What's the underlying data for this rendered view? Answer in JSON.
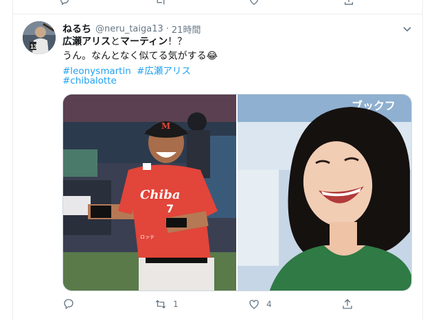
{
  "tweet": {
    "display_name": "ねるち",
    "handle": "@neru_taiga13",
    "separator": "·",
    "time": "21時間",
    "text_parts": {
      "name1": "広瀬アリス",
      "connector": "と",
      "name2": "マーティン",
      "ending": "！？"
    },
    "line2": "うん。なんとなく似てる気がする😂",
    "hashtags": [
      "#leonysmartin",
      "#広瀬アリス",
      "#chibalotte"
    ],
    "photo_left": {
      "jersey_text": "Chiba",
      "number": "7",
      "badge": "ロッテ"
    },
    "photo_right": {
      "sign_text": "ブックフ"
    },
    "actions": {
      "reply_count": "",
      "retweet_count": "1",
      "like_count": "4",
      "share_count": ""
    }
  },
  "colors": {
    "link": "#1da1f2",
    "muted": "#657786",
    "border": "#e6ecf0"
  }
}
